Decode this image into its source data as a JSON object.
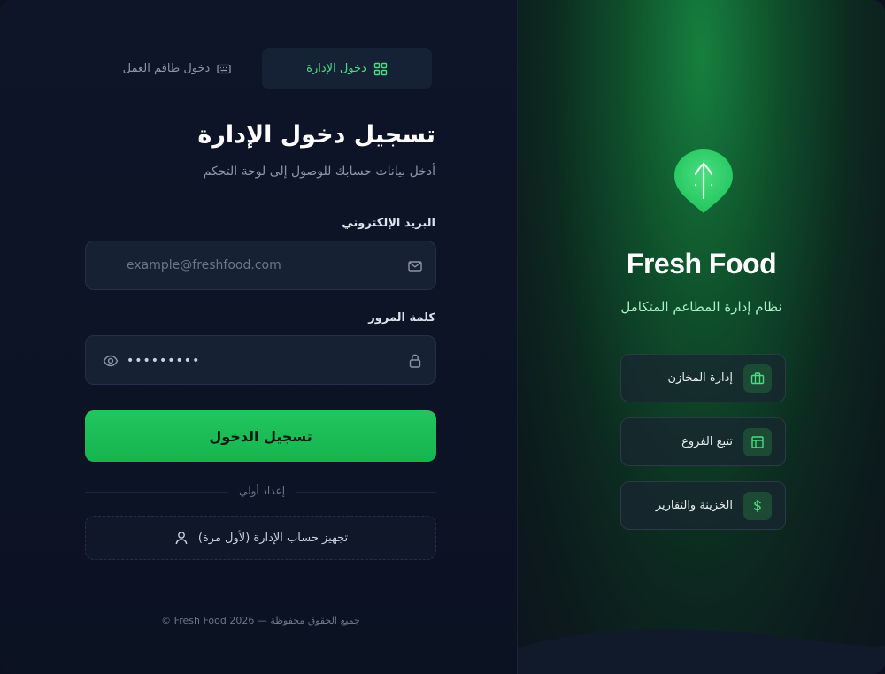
{
  "tabs": {
    "admin_label": "دخول الإدارة",
    "staff_label": "دخول طاقم العمل"
  },
  "form": {
    "title": "تسجيل دخول الإدارة",
    "subtitle": "أدخل بيانات حسابك للوصول إلى لوحة التحكم",
    "email_label": "البريد الإلكتروني",
    "email_placeholder": "example@freshfood.com",
    "password_label": "كلمة المرور",
    "password_value": "•••••••••",
    "submit_label": "تسجيل الدخول",
    "divider_text": "إعداد أولي",
    "setup_label": "تجهيز حساب الإدارة (لأول مرة)",
    "footer": "© Fresh Food 2026 — جميع الحقوق محفوظة"
  },
  "brand": {
    "name": "Fresh Food",
    "tagline": "نظام إدارة المطاعم المتكامل",
    "features": [
      {
        "label": "إدارة المخازن",
        "icon": "briefcase-icon"
      },
      {
        "label": "تتبع الفروع",
        "icon": "layout-icon"
      },
      {
        "label": "الخزينة والتقارير",
        "icon": "dollar-icon"
      }
    ]
  },
  "colors": {
    "accent": "#22c55e",
    "background": "#0d1426",
    "accent_text": "#4ade80"
  }
}
